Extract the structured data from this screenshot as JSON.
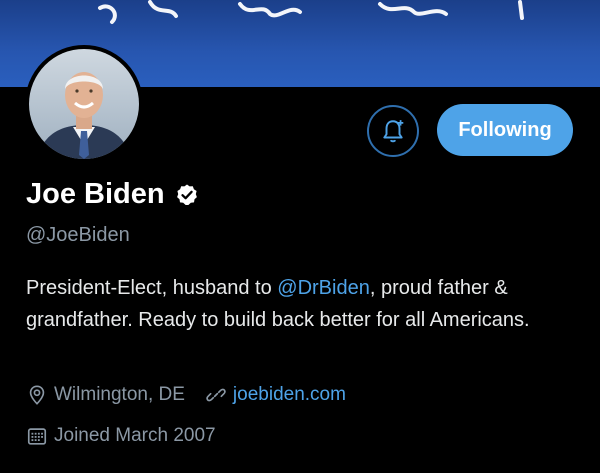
{
  "banner": {
    "color": "#2756b0"
  },
  "profile": {
    "name": "Joe Biden",
    "handle": "@JoeBiden",
    "verified": true,
    "bio_before": "President-Elect, husband to ",
    "bio_mention": "@DrBiden",
    "bio_after": ", proud father & grandfather. Ready to build back better for all Americans.",
    "location": "Wilmington, DE",
    "website": "joebiden.com",
    "joined": "Joined March 2007"
  },
  "actions": {
    "notify_icon": "bell-plus-icon",
    "follow_label": "Following"
  },
  "colors": {
    "accent": "#4ea3e8",
    "muted": "#8b98a5",
    "background": "#000000"
  }
}
